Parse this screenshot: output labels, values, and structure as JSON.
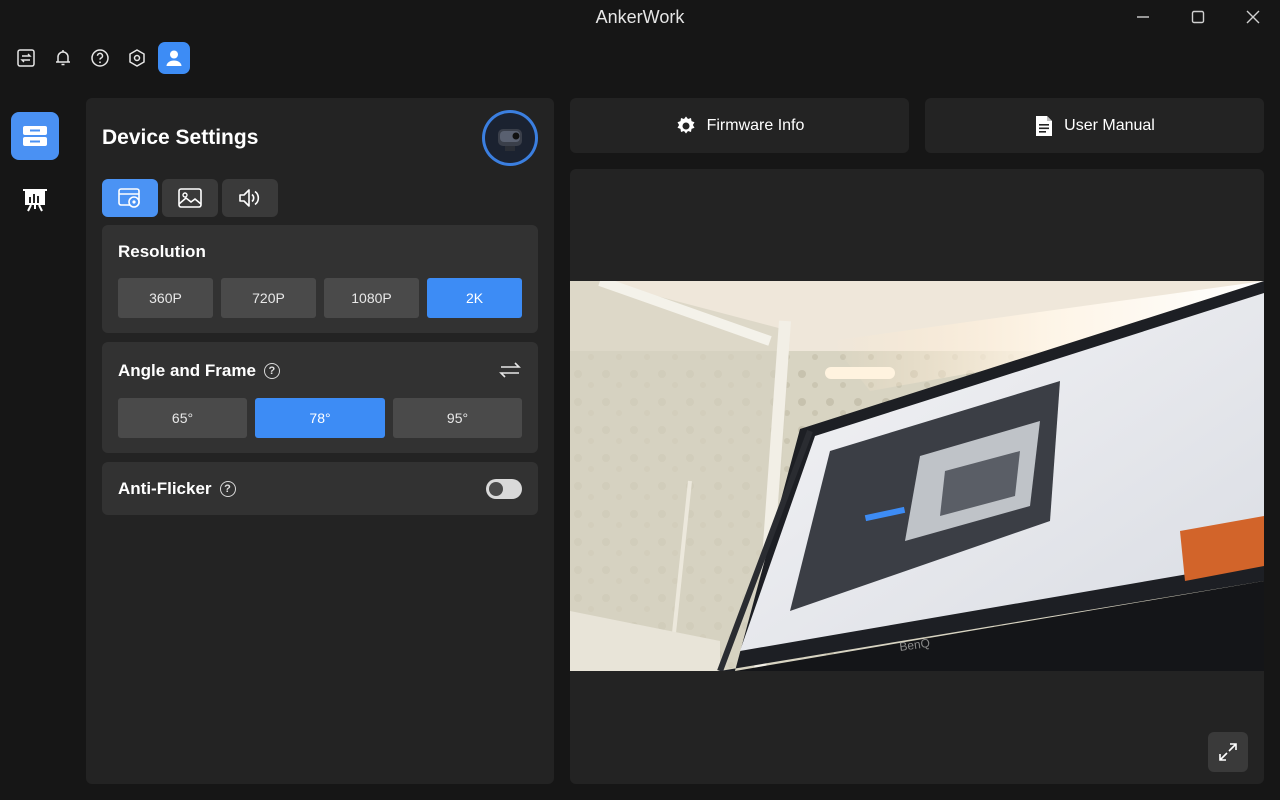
{
  "app": {
    "title": "AnkerWork"
  },
  "window_controls": {
    "minimize": "minimize-icon",
    "maximize": "maximize-icon",
    "close": "close-icon"
  },
  "toolbar": {
    "icons": [
      "switch-device-icon",
      "bell-icon",
      "help-icon",
      "settings-hex-icon",
      "user-avatar-icon"
    ]
  },
  "sidebar": {
    "items": [
      {
        "icon": "device-settings-icon",
        "active": true
      },
      {
        "icon": "presentation-chart-icon",
        "active": false
      }
    ]
  },
  "device_settings": {
    "title": "Device Settings",
    "tabs": [
      {
        "icon": "camera-settings-icon",
        "active": true
      },
      {
        "icon": "image-icon",
        "active": false
      },
      {
        "icon": "speaker-icon",
        "active": false
      }
    ],
    "resolution": {
      "title": "Resolution",
      "options": [
        "360P",
        "720P",
        "1080P",
        "2K"
      ],
      "selected": "2K"
    },
    "angle": {
      "title": "Angle and Frame",
      "options": [
        "65°",
        "78°",
        "95°"
      ],
      "selected": "78°"
    },
    "anti_flicker": {
      "title": "Anti-Flicker",
      "enabled": false
    }
  },
  "actions": {
    "firmware_label": "Firmware Info",
    "manual_label": "User Manual"
  },
  "preview": {
    "monitor_brand": "BenQ"
  },
  "colors": {
    "accent": "#3d8cf5",
    "panel": "#232323",
    "card": "#323232",
    "background": "#161616"
  }
}
